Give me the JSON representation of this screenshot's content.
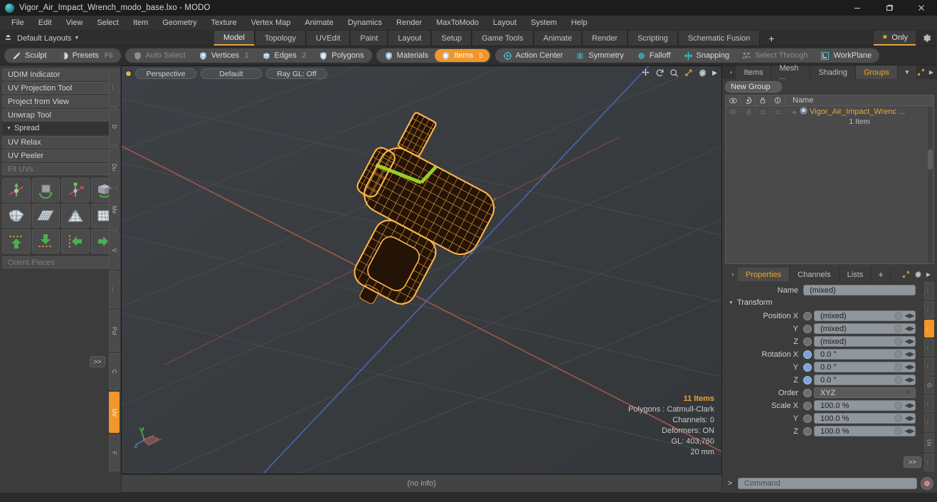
{
  "window": {
    "title": "Vigor_Air_Impact_Wrench_modo_base.lxo - MODO",
    "app_icon": "modo-sphere-icon",
    "minimize": "minimize-icon",
    "maximize": "restore-icon",
    "close": "close-icon"
  },
  "menubar": {
    "items": [
      "File",
      "Edit",
      "View",
      "Select",
      "Item",
      "Geometry",
      "Texture",
      "Vertex Map",
      "Animate",
      "Dynamics",
      "Render",
      "MaxToModo",
      "Layout",
      "System",
      "Help"
    ]
  },
  "layoutbar": {
    "preset_label": "Default Layouts",
    "tabs": [
      {
        "label": "Model",
        "active": true
      },
      {
        "label": "Topology",
        "active": false
      },
      {
        "label": "UVEdit",
        "active": false
      },
      {
        "label": "Paint",
        "active": false
      },
      {
        "label": "Layout",
        "active": false
      },
      {
        "label": "Setup",
        "active": false
      },
      {
        "label": "Game Tools",
        "active": false
      },
      {
        "label": "Animate",
        "active": false
      },
      {
        "label": "Render",
        "active": false
      },
      {
        "label": "Scripting",
        "active": false
      },
      {
        "label": "Schematic Fusion",
        "active": false
      }
    ],
    "add_tab": "+",
    "only_label": "Only",
    "only_star": "star-icon",
    "gear": "gear-icon"
  },
  "modebar": {
    "group1": [
      {
        "label": "Sculpt",
        "icon": "sculpt-brush-icon",
        "state": "normal",
        "hint": ""
      },
      {
        "label": "Presets",
        "icon": "presets-sphere-icon",
        "state": "normal",
        "hint": "F6"
      }
    ],
    "group2": [
      {
        "label": "Auto Select",
        "icon": "shield-icon",
        "state": "dim",
        "hint": ""
      },
      {
        "label": "Vertices",
        "icon": "vertices-icon",
        "state": "normal",
        "hint": "1"
      },
      {
        "label": "Edges",
        "icon": "edges-icon",
        "state": "normal",
        "hint": "2"
      },
      {
        "label": "Polygons",
        "icon": "polygons-icon",
        "state": "normal",
        "hint": ""
      }
    ],
    "group3": [
      {
        "label": "Materials",
        "icon": "materials-icon",
        "state": "normal",
        "hint": ""
      },
      {
        "label": "Items",
        "icon": "items-icon",
        "state": "selected",
        "hint": "5"
      }
    ],
    "group4": [
      {
        "label": "Action Center",
        "icon": "action-center-icon",
        "state": "normal",
        "hint": ""
      },
      {
        "label": "Symmetry",
        "icon": "symmetry-icon",
        "state": "normal",
        "hint": ""
      },
      {
        "label": "Falloff",
        "icon": "falloff-icon",
        "state": "normal",
        "hint": ""
      },
      {
        "label": "Snapping",
        "icon": "snapping-icon",
        "state": "normal",
        "hint": ""
      },
      {
        "label": "Select Through",
        "icon": "select-through-icon",
        "state": "dim",
        "hint": ""
      },
      {
        "label": "WorkPlane",
        "icon": "workplane-icon",
        "state": "normal",
        "hint": ""
      }
    ]
  },
  "leftpanel": {
    "buttons": [
      {
        "label": "UDIM Indicator",
        "type": "button",
        "dim": false
      },
      {
        "label": "UV Projection Tool",
        "type": "button",
        "dim": false
      },
      {
        "label": "Project from View",
        "type": "button",
        "dim": false
      },
      {
        "label": "Unwrap Tool",
        "type": "button",
        "dim": false
      }
    ],
    "section": {
      "label": "Spread",
      "collapsed": false
    },
    "buttons2": [
      {
        "label": "UV Relax",
        "type": "button",
        "dim": false
      },
      {
        "label": "UV Peeler",
        "type": "button",
        "dim": false
      },
      {
        "label": "Fit UVs",
        "type": "button",
        "dim": true
      }
    ],
    "icon_rows": [
      [
        "uv-move-icon",
        "uv-rotate-icon",
        "uv-scale-icon",
        "uv-flip-icon"
      ],
      [
        "uv-fit-icon",
        "uv-grid-icon",
        "uv-taper-icon",
        "uv-relax-grid-icon"
      ],
      [
        "uv-align-up-icon",
        "uv-align-down-icon",
        "uv-align-left-icon",
        "uv-align-right-icon"
      ]
    ],
    "orient": {
      "label": "Orient Pieces",
      "dim": true
    },
    "more": ">>",
    "vtabs": [
      {
        "label": "...",
        "active": false
      },
      {
        "label": "D",
        "active": false
      },
      {
        "label": "Du",
        "active": false
      },
      {
        "label": "Me",
        "active": false
      },
      {
        "label": "V",
        "active": false
      },
      {
        "label": "...",
        "active": false
      },
      {
        "label": "Pol",
        "active": false
      },
      {
        "label": "C",
        "active": false
      },
      {
        "label": "UV",
        "active": true
      },
      {
        "label": "F",
        "active": false
      }
    ]
  },
  "viewport": {
    "view_mode": "Perspective",
    "shading": "Default",
    "raygl": "Ray GL: Off",
    "tools": [
      "pan-icon",
      "rotate-icon",
      "zoom-icon",
      "fit-icon",
      "viewport-settings-icon",
      "more-arrow-icon"
    ],
    "stats": {
      "items": "11 Items",
      "polygons": "Polygons : Catmull-Clark",
      "channels": "Channels: 0",
      "deformers": "Deformers: ON",
      "gl": "GL: 403,760",
      "grid": "20 mm"
    },
    "gizmo": {
      "y": "Y",
      "z": "Z"
    },
    "model_name": "air-impact-wrench-wireframe",
    "wire_color": "#f0a030",
    "highlight_color": "#9ad82a",
    "bg_color": "#3a3d40"
  },
  "rightpanel": {
    "tabs": [
      {
        "label": "Items",
        "active": false
      },
      {
        "label": "Mesh ...",
        "active": false
      },
      {
        "label": "Shading",
        "active": false
      },
      {
        "label": "Groups",
        "active": true
      }
    ],
    "tab_dropdown": "chevron-down-icon",
    "expand": "expand-icon",
    "more": "more-arrow-icon",
    "new_group_button": "New Group",
    "list_header": {
      "cols": [
        "eye-icon",
        "render-icon",
        "lock-icon",
        "info-icon"
      ],
      "name": "Name"
    },
    "list_rows": [
      {
        "name": "Vigor_Air_Impact_Wrenc ...",
        "icon": "group-icon",
        "sub": "1 Item",
        "selected": true
      }
    ]
  },
  "properties": {
    "tabs": [
      {
        "label": "Properties",
        "active": true
      },
      {
        "label": "Channels",
        "active": false
      },
      {
        "label": "Lists",
        "active": false
      },
      {
        "label": "+",
        "active": false
      }
    ],
    "expand": "expand-icon",
    "gear": "gear-icon",
    "more": "more-arrow-icon",
    "name_label": "Name",
    "name_value": "(mixed)",
    "transform_section": "Transform",
    "rows": [
      {
        "label": "Position X",
        "value": "(mixed)",
        "knob": "grey"
      },
      {
        "label": "Y",
        "value": "(mixed)",
        "knob": "grey"
      },
      {
        "label": "Z",
        "value": "(mixed)",
        "knob": "grey"
      },
      {
        "label": "Rotation X",
        "value": "0.0 °",
        "knob": "blue"
      },
      {
        "label": "Y",
        "value": "0.0 °",
        "knob": "blue"
      },
      {
        "label": "Z",
        "value": "0.0 °",
        "knob": "blue"
      }
    ],
    "order_label": "Order",
    "order_value": "XYZ",
    "scale_rows": [
      {
        "label": "Scale X",
        "value": "100.0 %",
        "knob": "grey"
      },
      {
        "label": "Y",
        "value": "100.0 %",
        "knob": "grey"
      },
      {
        "label": "Z",
        "value": "100.0 %",
        "knob": "grey"
      }
    ],
    "more_button": ">>",
    "vtabs": [
      {
        "label": "...",
        "active": false
      },
      {
        "label": "...",
        "active": false
      },
      {
        "label": "...",
        "active": true
      },
      {
        "label": "...",
        "active": false
      },
      {
        "label": "...",
        "active": false
      },
      {
        "label": "G",
        "active": false
      },
      {
        "label": "...",
        "active": false
      },
      {
        "label": "...",
        "active": false
      },
      {
        "label": "Us",
        "active": false
      },
      {
        "label": "...",
        "active": false
      }
    ]
  },
  "bottombar": {
    "info": "(no info)",
    "command_arrow": ">",
    "command_placeholder": "Command",
    "record_button": "record-icon"
  },
  "colors": {
    "accent": "#f0962a",
    "highlight_text": "#e8a33d",
    "panel_bg": "#3c3c3c",
    "window_bg": "#2b2b2b",
    "field_bg": "#8f969c"
  }
}
